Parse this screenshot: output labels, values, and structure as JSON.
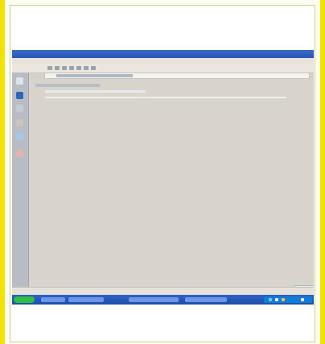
{
  "colors": {
    "accent": "#f2e300",
    "taskbar": "#1f4da9",
    "titlebar": "#2854b4",
    "window_bg": "#d6d2c9"
  },
  "icons": {
    "sidebar": [
      "back-icon",
      "home-icon",
      "settings-icon",
      "search-icon",
      "document-icon",
      "warning-icon"
    ],
    "toolbar": [
      "back-icon",
      "forward-icon",
      "stop-icon",
      "refresh-icon",
      "home-icon",
      "search-icon",
      "favorites-icon"
    ],
    "tray": [
      "network-icon",
      "volume-icon",
      "security-icon",
      "time-icon"
    ]
  },
  "screen": {
    "address_text": "",
    "title_text": "",
    "status_text": ""
  }
}
